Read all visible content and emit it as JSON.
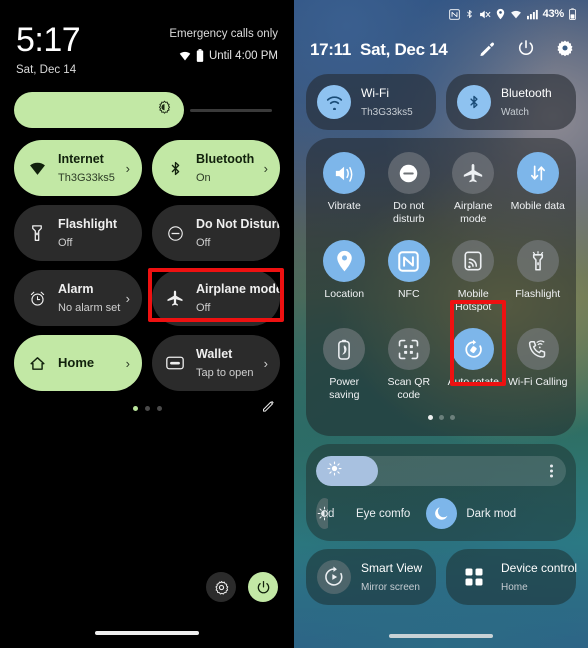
{
  "colors": {
    "accent_green": "#c2e8a5",
    "accent_blue": "#7db6ea",
    "highlight_red": "#ee1111",
    "panel_a_bg": "#000000"
  },
  "panel_a": {
    "name": "android-quick-settings",
    "clock": "5:17",
    "date": "Sat, Dec 14",
    "carrier_status": "Emergency calls only",
    "battery_status": "Until 4:00 PM",
    "status_icons": [
      "wifi-icon",
      "battery-icon"
    ],
    "brightness": {
      "icon": "brightness-icon",
      "value_percent": 62
    },
    "tiles": [
      {
        "title": "Internet",
        "subtitle": "Th3G33ks5",
        "icon": "wifi-icon",
        "state": "on",
        "chevron": true
      },
      {
        "title": "Bluetooth",
        "subtitle": "On",
        "icon": "bluetooth-icon",
        "state": "on",
        "chevron": true
      },
      {
        "title": "Flashlight",
        "subtitle": "Off",
        "icon": "flashlight-icon",
        "state": "off",
        "chevron": false
      },
      {
        "title": "Do Not Disturb",
        "subtitle": "Off",
        "icon": "do-not-disturb-icon",
        "state": "off",
        "chevron": false
      },
      {
        "title": "Alarm",
        "subtitle": "No alarm set",
        "icon": "alarm-icon",
        "state": "off",
        "chevron": true
      },
      {
        "title": "Airplane mode",
        "subtitle": "Off",
        "icon": "airplane-icon",
        "state": "off",
        "chevron": false
      },
      {
        "title": "Home",
        "subtitle": "",
        "icon": "home-icon",
        "state": "on",
        "chevron": true
      },
      {
        "title": "Wallet",
        "subtitle": "Tap to open",
        "icon": "wallet-icon",
        "state": "off",
        "chevron": true
      }
    ],
    "page_dots": {
      "count": 3,
      "active_index": 0
    },
    "edit_icon": "pencil-icon",
    "footer_buttons": [
      {
        "icon": "gear-icon",
        "name": "settings-button"
      },
      {
        "icon": "power-icon",
        "name": "power-button"
      }
    ]
  },
  "panel_b": {
    "name": "oneui-quick-panel",
    "status_bar": {
      "icons": [
        "nfc-icon",
        "bluetooth-icon",
        "mute-icon",
        "location-icon",
        "wifi-icon",
        "signal-icon"
      ],
      "battery_percent": "43%",
      "battery_icon": "battery-icon"
    },
    "header": {
      "time": "17:11",
      "date": "Sat, Dec 14",
      "icons": [
        "pencil-icon",
        "power-icon",
        "gear-icon"
      ]
    },
    "top_tiles": [
      {
        "title": "Wi-Fi",
        "subtitle": "Th3G33ks5",
        "icon": "wifi-icon",
        "state": "on"
      },
      {
        "title": "Bluetooth",
        "subtitle": "Watch",
        "icon": "bluetooth-icon",
        "state": "on"
      }
    ],
    "quick_tiles": [
      {
        "label": "Vibrate",
        "icon": "vibrate-icon",
        "state": "on"
      },
      {
        "label": "Do not disturb",
        "icon": "do-not-disturb-icon",
        "state": "off"
      },
      {
        "label": "Airplane mode",
        "icon": "airplane-icon",
        "state": "off"
      },
      {
        "label": "Mobile data",
        "icon": "mobile-data-icon",
        "state": "on"
      },
      {
        "label": "Location",
        "icon": "location-icon",
        "state": "on"
      },
      {
        "label": "NFC",
        "icon": "nfc-icon",
        "state": "on"
      },
      {
        "label": "Mobile Hotspot",
        "icon": "hotspot-icon",
        "state": "off"
      },
      {
        "label": "Flashlight",
        "icon": "flashlight-icon",
        "state": "off"
      },
      {
        "label": "Power saving",
        "icon": "power-saving-icon",
        "state": "off"
      },
      {
        "label": "Scan QR code",
        "icon": "qr-scan-icon",
        "state": "off"
      },
      {
        "label": "Auto rotate",
        "icon": "auto-rotate-icon",
        "state": "on"
      },
      {
        "label": "Wi-Fi Calling",
        "icon": "wifi-calling-icon",
        "state": "off"
      }
    ],
    "quick_page_dots": {
      "count": 3,
      "active_index": 0
    },
    "brightness": {
      "icon": "brightness-icon",
      "value_percent": 23,
      "menu_icon": "kebab-menu-icon"
    },
    "display_toggles": [
      {
        "label": "d",
        "icon": "truncated-icon",
        "state": "off",
        "truncated": true
      },
      {
        "label": "Eye comfo",
        "icon": "eye-comfort-icon",
        "state": "off",
        "truncated": true
      },
      {
        "label": "Dark mod",
        "icon": "dark-mode-icon",
        "state": "on",
        "truncated": true
      }
    ],
    "bottom_tiles": [
      {
        "title": "Smart View",
        "subtitle": "Mirror screen",
        "icon": "smart-view-icon"
      },
      {
        "title": "Device control",
        "subtitle": "Home",
        "icon": "device-control-icon"
      }
    ]
  },
  "annotations": [
    {
      "name": "airplane-mode-highlight-left",
      "target": "Airplane mode",
      "color": "#ee1111"
    },
    {
      "name": "airplane-mode-highlight-right",
      "target": "Airplane mode",
      "color": "#ee1111"
    }
  ]
}
